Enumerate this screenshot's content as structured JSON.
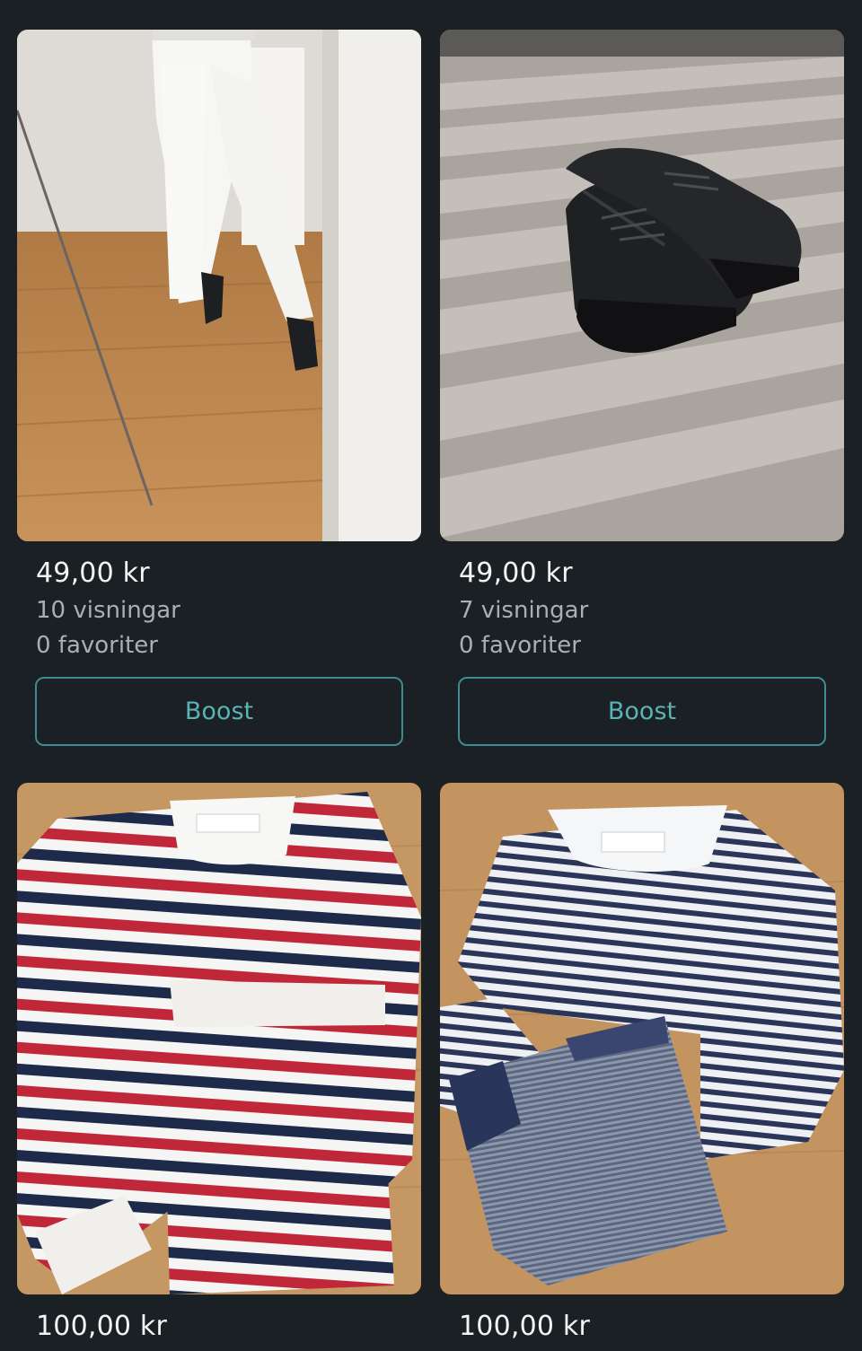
{
  "listings": [
    {
      "price": "49,00 kr",
      "views": "10 visningar",
      "favorites": "0 favoriter",
      "boost_label": "Boost",
      "photo": "white-trousers-photo"
    },
    {
      "price": "49,00 kr",
      "views": "7 visningar",
      "favorites": "0 favoriter",
      "boost_label": "Boost",
      "photo": "black-sneakers-photo"
    },
    {
      "price": "100,00 kr",
      "photo": "red-navy-striped-set-photo"
    },
    {
      "price": "100,00 kr",
      "photo": "navy-striped-set-photo"
    }
  ],
  "colors": {
    "background": "#1a2023",
    "accent": "#59b3b7",
    "muted_text": "#a9b0b3"
  }
}
